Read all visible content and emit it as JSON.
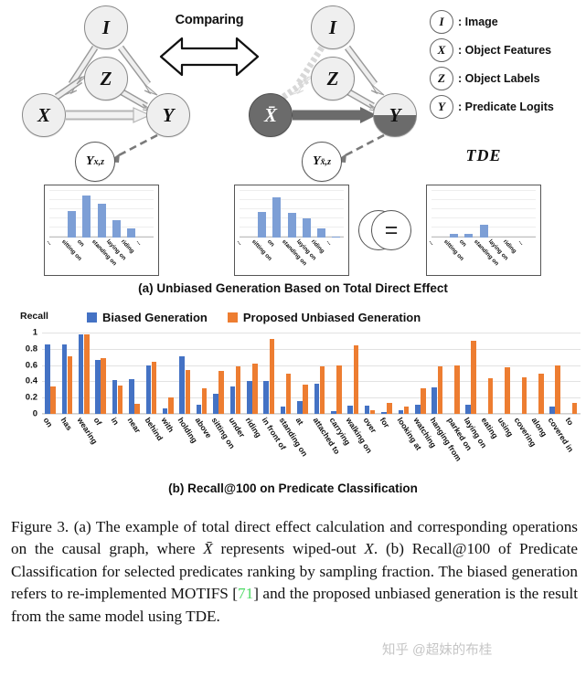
{
  "panel_a": {
    "comparing_label": "Comparing",
    "caption": "(a) Unbiased Generation Based on Total Direct Effect",
    "tde_label": "TDE",
    "left_graph": {
      "nodes": [
        {
          "id": "I",
          "label": "I"
        },
        {
          "id": "Z",
          "label": "Z"
        },
        {
          "id": "X",
          "label": "X"
        },
        {
          "id": "Y",
          "label": "Y"
        }
      ],
      "output_node": "Y",
      "output_sub": "x,z"
    },
    "right_graph": {
      "nodes": [
        {
          "id": "I",
          "label": "I"
        },
        {
          "id": "Z",
          "label": "Z"
        },
        {
          "id": "Xbar",
          "label": "X̄"
        },
        {
          "id": "Y",
          "label": "Y"
        }
      ],
      "output_node": "Y",
      "output_sub": "x̄,z"
    },
    "operators": {
      "minus": "−",
      "equals": "="
    },
    "mini_charts": [
      {
        "name": "biased-distribution",
        "categories": [
          "...",
          "sitting on",
          "on",
          "standing on",
          "laying on",
          "riding",
          "..."
        ],
        "values": [
          0.0,
          0.58,
          0.93,
          0.75,
          0.38,
          0.21,
          0.0
        ]
      },
      {
        "name": "counterfactual-distribution",
        "categories": [
          "...",
          "sitting on",
          "on",
          "standing on",
          "laying on",
          "riding",
          "..."
        ],
        "values": [
          0.0,
          0.56,
          0.89,
          0.55,
          0.42,
          0.21,
          0.02
        ]
      },
      {
        "name": "tde-distribution",
        "categories": [
          "...",
          "sitting on",
          "on",
          "standing on",
          "laying on",
          "riding",
          "..."
        ],
        "values": [
          0.0,
          0.08,
          0.08,
          0.29,
          0.0,
          0.0,
          0.0
        ]
      }
    ]
  },
  "legend_panel": {
    "items": [
      {
        "symbol": "I",
        "text": ": Image"
      },
      {
        "symbol": "X",
        "text": ": Object Features"
      },
      {
        "symbol": "Z",
        "text": ": Object Labels"
      },
      {
        "symbol": "Y",
        "text": ": Predicate Logits"
      }
    ]
  },
  "panel_b": {
    "caption": "(b) Recall@100 on Predicate Classification",
    "axis_title": "Recall",
    "colors": {
      "biased": "#4472c4",
      "unbiased": "#ed7d31"
    }
  },
  "chart_data": {
    "type": "bar",
    "title": "(b) Recall@100 on Predicate Classification",
    "xlabel": "",
    "ylabel": "Recall",
    "ylim": [
      0,
      1
    ],
    "yticks": [
      "0",
      "0.2",
      "0.4",
      "0.6",
      "0.8",
      "1"
    ],
    "grid": true,
    "legend_position": "top",
    "categories": [
      "on",
      "has",
      "wearing",
      "of",
      "in",
      "near",
      "behind",
      "with",
      "holding",
      "above",
      "sitting on",
      "under",
      "riding",
      "in front of",
      "standing on",
      "at",
      "attached to",
      "carrying",
      "walking on",
      "over",
      "for",
      "looking at",
      "watching",
      "hanging from",
      "parked on",
      "laying on",
      "eating",
      "using",
      "covering",
      "along",
      "covered in",
      "to"
    ],
    "series": [
      {
        "name": "Biased Generation",
        "color": "#4472c4",
        "values": [
          0.85,
          0.85,
          0.98,
          0.66,
          0.42,
          0.43,
          0.6,
          0.07,
          0.71,
          0.11,
          0.25,
          0.34,
          0.4,
          0.41,
          0.09,
          0.16,
          0.37,
          0.03,
          0.1,
          0.1,
          0.02,
          0.05,
          0.11,
          0.33,
          0.0,
          0.11,
          0.0,
          0.0,
          0.0,
          0.0,
          0.09,
          0.0
        ]
      },
      {
        "name": "Proposed Unbiased Generation",
        "color": "#ed7d31",
        "values": [
          0.34,
          0.71,
          0.98,
          0.69,
          0.35,
          0.12,
          0.64,
          0.2,
          0.54,
          0.31,
          0.53,
          0.58,
          0.62,
          0.92,
          0.5,
          0.36,
          0.59,
          0.6,
          0.84,
          0.04,
          0.14,
          0.09,
          0.31,
          0.59,
          0.6,
          0.9,
          0.44,
          0.57,
          0.45,
          0.5,
          0.6,
          0.13
        ]
      }
    ]
  },
  "figure_caption": {
    "prefix": "Figure 3. (a) The example of total direct effect calculation and corresponding operations on the causal graph, where ",
    "xbar": "X̄",
    "mid1": " represents wiped-out ",
    "x": "X",
    "mid2": ". (b) Recall@100 of Predicate Classification for selected predicates ranking by sampling fraction. The biased generation refers to re-implemented MOTIFS [",
    "ref": "71",
    "mid3": "] and the proposed unbiased generation is the result from the same model using TDE."
  },
  "watermark": {
    "text": "知乎 @超妹的布桂"
  }
}
